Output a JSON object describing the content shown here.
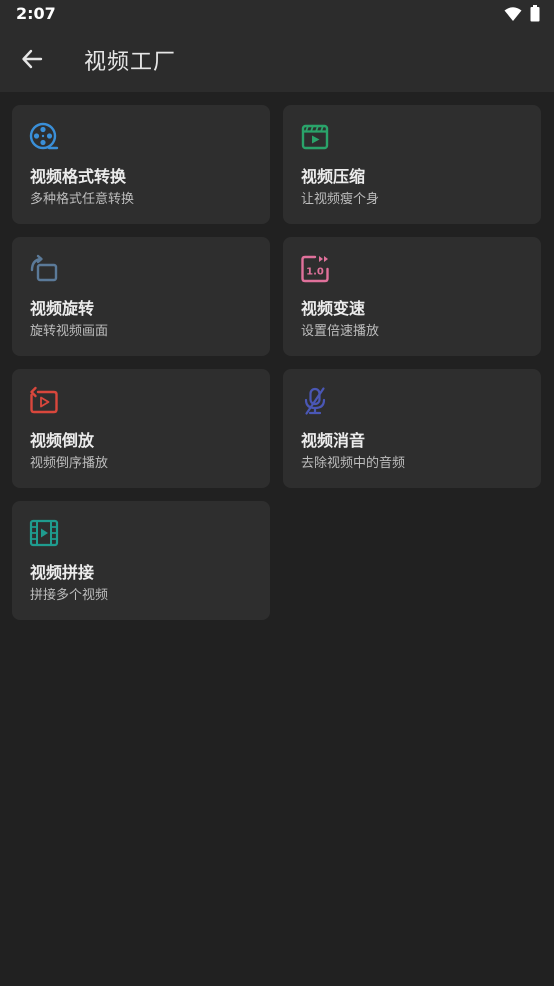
{
  "status_bar": {
    "time": "2:07",
    "wifi_icon": "wifi-icon",
    "battery_icon": "battery-icon"
  },
  "app_bar": {
    "title": "视频工厂",
    "back_icon": "arrow-back-icon"
  },
  "colors": {
    "background": "#212121",
    "card": "#2e2e2e",
    "format_convert": "#3a8fd8",
    "compress": "#2aa36a",
    "rotate": "#5b7a99",
    "speed": "#e0719b",
    "reverse": "#d9473c",
    "mute": "#4a57b5",
    "merge": "#1f9c8f"
  },
  "cards": [
    {
      "id": "format-convert",
      "title": "视频格式转换",
      "subtitle": "多种格式任意转换",
      "icon": "film-reel-icon"
    },
    {
      "id": "compress",
      "title": "视频压缩",
      "subtitle": "让视频瘦个身",
      "icon": "video-compress-icon"
    },
    {
      "id": "rotate",
      "title": "视频旋转",
      "subtitle": "旋转视频画面",
      "icon": "rotate-icon"
    },
    {
      "id": "speed",
      "title": "视频变速",
      "subtitle": "设置倍速播放",
      "icon": "speed-icon",
      "icon_text": "1.0"
    },
    {
      "id": "reverse",
      "title": "视频倒放",
      "subtitle": "视频倒序播放",
      "icon": "reverse-play-icon"
    },
    {
      "id": "mute",
      "title": "视频消音",
      "subtitle": "去除视频中的音频",
      "icon": "mic-off-icon"
    },
    {
      "id": "merge",
      "title": "视频拼接",
      "subtitle": "拼接多个视频",
      "icon": "film-strip-icon"
    }
  ]
}
